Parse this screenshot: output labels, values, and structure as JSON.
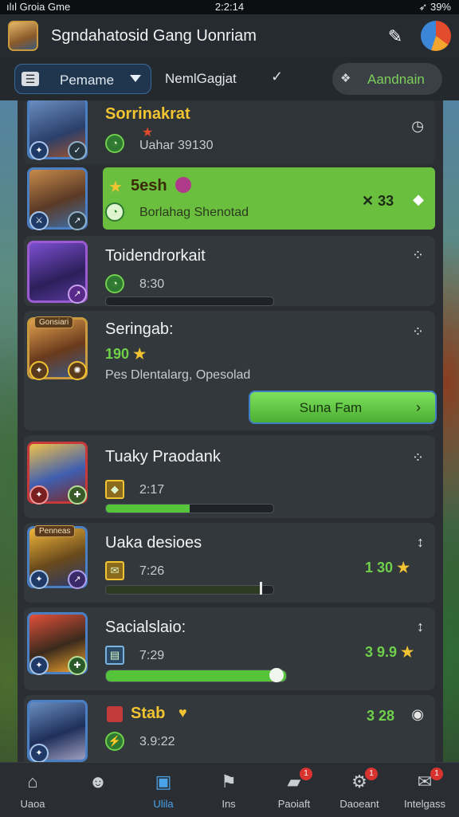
{
  "status_bar": {
    "carrier": "ılıl Groia Gme",
    "time": "2:2:14",
    "battery": "39%"
  },
  "header": {
    "title": "Sgndahatosid Gang Uonriam",
    "pen_icon": "pen-icon",
    "browser_icon": "browser-icon"
  },
  "filters": {
    "select_label": "Pemame",
    "tab_label": "NemlGagjat",
    "check_glyph": "✓",
    "action_label": "Aandnain"
  },
  "rows": [
    {
      "name": "Sorrinakrat",
      "sub": "Uahar 39130",
      "right_glyph": "◷"
    },
    {
      "name": "5esh",
      "sub": "Borlahag Shenotad",
      "right_value": "✕ 33",
      "right_glyph": "◆"
    },
    {
      "name": "Toidendrorkait",
      "sub": "8:30",
      "progress": 0.0,
      "right_glyph": "⁘"
    },
    {
      "name": "Seringab:",
      "tag": "Gonsiari",
      "value": "190",
      "sub": "Pes Dlentalarg, Opesolad",
      "button_label": "Suna Fam",
      "right_glyph": "⁘"
    },
    {
      "name": "Tuaky Praodank",
      "sub": "2:17",
      "progress": 0.5,
      "right_glyph": "⁘"
    },
    {
      "name": "Uaka desioes",
      "tag": "Penneas",
      "sub": "7:26",
      "progress": 0.93,
      "right_value": "1 30",
      "right_glyph": "↕"
    },
    {
      "name": "Sacialslaio:",
      "sub": "7:29",
      "progress": 1.0,
      "right_value": "3 9.9",
      "right_glyph": "↕"
    },
    {
      "name": "Stab",
      "sub": "3.9:22",
      "right_value": "3 28",
      "right_glyph": "◉"
    }
  ],
  "nav": [
    {
      "label": "Uaoa",
      "icon": "home-icon",
      "badge": ""
    },
    {
      "label": "",
      "icon": "friends-icon",
      "badge": ""
    },
    {
      "label": "Ulila",
      "icon": "list-icon",
      "badge": ""
    },
    {
      "label": "Ins",
      "icon": "inventory-icon",
      "badge": ""
    },
    {
      "label": "Paoiaft",
      "icon": "chest-icon",
      "badge": "1"
    },
    {
      "label": "Daoeant",
      "icon": "settings-icon",
      "badge": "1"
    },
    {
      "label": "Intelgass",
      "icon": "messages-icon",
      "badge": "1"
    }
  ],
  "colors": {
    "accent_green": "#6abf3f",
    "accent_blue": "#4aa3e8",
    "gold": "#f2c431"
  }
}
